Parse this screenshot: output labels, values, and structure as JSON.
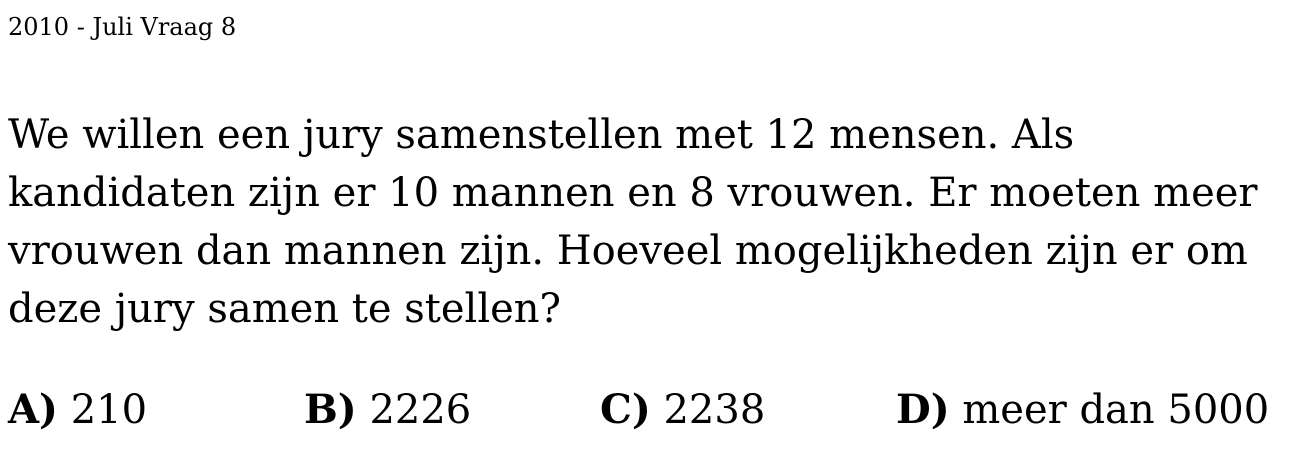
{
  "header": {
    "title": "2010 - Juli Vraag 8"
  },
  "question": {
    "lines": [
      "We willen een jury samenstellen met 12 mensen. Als",
      "kandidaten zijn er 10 mannen en 8 vrouwen. Er moeten meer",
      "vrouwen dan mannen zijn. Hoeveel mogelijkheden zijn er om",
      "deze jury samen te stellen?"
    ]
  },
  "answers": [
    {
      "letter": "A)",
      "value": "210"
    },
    {
      "letter": "B)",
      "value": "2226"
    },
    {
      "letter": "C)",
      "value": "2238"
    },
    {
      "letter": "D)",
      "value": "meer dan 5000"
    }
  ]
}
